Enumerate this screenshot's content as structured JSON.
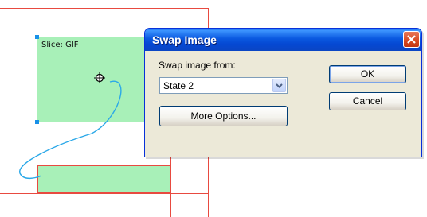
{
  "canvas": {
    "slice_label": "Slice: GIF"
  },
  "dialog": {
    "title": "Swap Image",
    "swap_from_label": "Swap image from:",
    "selected_state": "State 2",
    "ok_label": "OK",
    "cancel_label": "Cancel",
    "more_options_label": "More Options..."
  },
  "colors": {
    "slice_fill": "#a8f0b8",
    "guide_red": "#e84a40",
    "behavior_line": "#2aa8e8",
    "titlebar_blue": "#0a58e0"
  }
}
